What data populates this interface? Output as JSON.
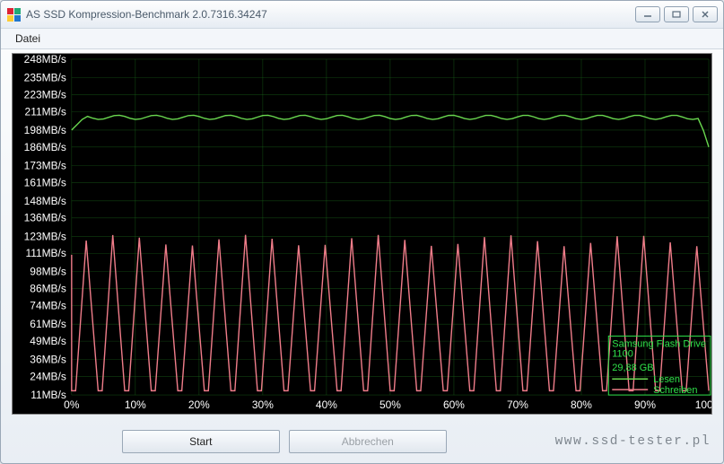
{
  "window": {
    "title": "AS SSD Kompression-Benchmark 2.0.7316.34247"
  },
  "menu": {
    "file": "Datei"
  },
  "buttons": {
    "start": "Start",
    "cancel": "Abbrechen"
  },
  "legend": {
    "device": "Samsung Flash Drive",
    "device2": "1100",
    "capacity": "29,88 GB",
    "read": "Lesen",
    "write": "Schreiben"
  },
  "watermark": "www.ssd-tester.pl",
  "chart_data": {
    "type": "line",
    "xlabel": "",
    "ylabel": "",
    "x_ticks": [
      "0%",
      "10%",
      "20%",
      "30%",
      "40%",
      "50%",
      "60%",
      "70%",
      "80%",
      "90%",
      "100%"
    ],
    "y_ticks": [
      "11MB/s",
      "24MB/s",
      "36MB/s",
      "49MB/s",
      "61MB/s",
      "74MB/s",
      "86MB/s",
      "98MB/s",
      "111MB/s",
      "123MB/s",
      "136MB/s",
      "148MB/s",
      "161MB/s",
      "173MB/s",
      "186MB/s",
      "198MB/s",
      "211MB/s",
      "223MB/s",
      "235MB/s",
      "248MB/s"
    ],
    "x_range_percent": [
      0,
      100
    ],
    "y_range_mbs": [
      11,
      248
    ],
    "series": [
      {
        "name": "Lesen",
        "color": "#69d84f",
        "approx_values_mbs": {
          "start": 198,
          "main": 207,
          "end": 186
        },
        "description": "Nearly flat line around 205-210 MB/s from 0% to ~99%, slight ripple ±2, small dip at start (~198) and drops to ~186 at 100%."
      },
      {
        "name": "Schreiben",
        "color": "#f07d8a",
        "pattern": "sawtooth",
        "low_mbs": 14,
        "high_mbs": 120,
        "cycles": 24,
        "description": "Repeating sharp sawtooth between ~14 MB/s and ~115-123 MB/s across 0-100%."
      }
    ]
  }
}
